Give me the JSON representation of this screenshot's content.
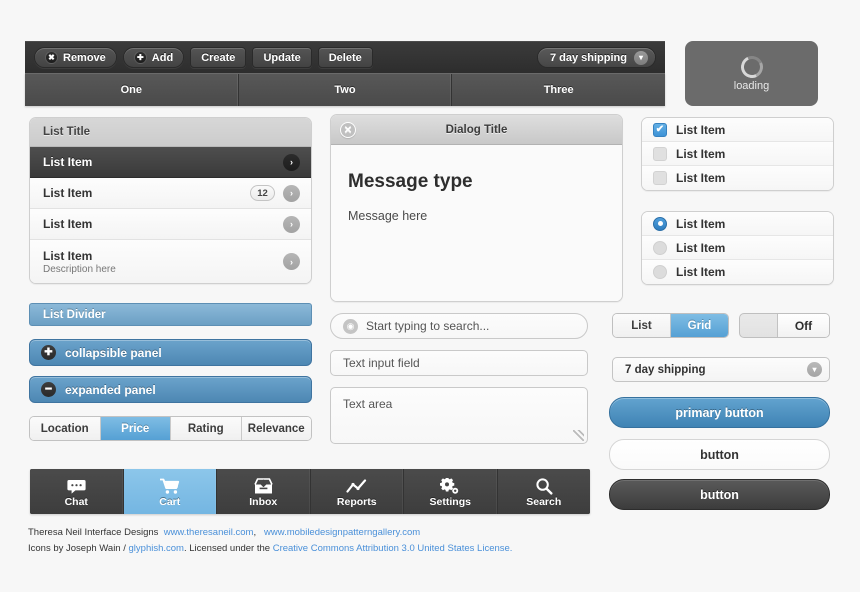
{
  "toolbar": {
    "buttons": [
      {
        "label": "Remove",
        "icon": "close-icon",
        "glyph": "✖",
        "pill": true
      },
      {
        "label": "Add",
        "icon": "plus-icon",
        "glyph": "✚",
        "pill": true
      },
      {
        "label": "Create",
        "icon": null,
        "glyph": "",
        "pill": false
      },
      {
        "label": "Update",
        "icon": null,
        "glyph": "",
        "pill": false
      },
      {
        "label": "Delete",
        "icon": null,
        "glyph": "",
        "pill": false
      }
    ],
    "select": {
      "value": "7 day shipping",
      "chevron": "❯"
    }
  },
  "tabs": [
    {
      "label": "One"
    },
    {
      "label": "Two"
    },
    {
      "label": "Three"
    }
  ],
  "loading": {
    "label": "loading"
  },
  "list": {
    "title": "List Title",
    "items": [
      {
        "label": "List Item",
        "description": "",
        "badge": "",
        "selected": true
      },
      {
        "label": "List Item",
        "description": "",
        "badge": "12",
        "selected": false
      },
      {
        "label": "List Item",
        "description": "",
        "badge": "",
        "selected": false
      },
      {
        "label": "List Item",
        "description": "Description here",
        "badge": "",
        "selected": false
      }
    ],
    "chevron": "❯"
  },
  "divider": {
    "label": "List Divider"
  },
  "panels": {
    "collapsible": {
      "label": "collapsible panel",
      "sign": "✚"
    },
    "expanded": {
      "label": "expanded panel",
      "sign": "━"
    }
  },
  "sort_segment": {
    "options": [
      "Location",
      "Price",
      "Rating",
      "Relevance"
    ],
    "selected": "Price"
  },
  "dialog": {
    "title": "Dialog Title",
    "close_icon": "✕",
    "heading": "Message type",
    "body": "Message here"
  },
  "fields": {
    "search": {
      "placeholder": "Start typing to search...",
      "icon": "search-icon",
      "glyph": "🔍"
    },
    "text_input": {
      "value": "Text input field"
    },
    "text_area": {
      "value": "Text area"
    }
  },
  "check_list": {
    "items": [
      {
        "label": "List Item",
        "checked": true
      },
      {
        "label": "List Item",
        "checked": false
      },
      {
        "label": "List Item",
        "checked": false
      }
    ],
    "check_glyph": "✔"
  },
  "radio_list": {
    "items": [
      {
        "label": "List Item",
        "selected": true
      },
      {
        "label": "List Item",
        "selected": false
      },
      {
        "label": "List Item",
        "selected": false
      }
    ]
  },
  "view_segment": {
    "options": [
      "List",
      "Grid"
    ],
    "selected": "Grid"
  },
  "toggle": {
    "state_label": "Off",
    "on": false
  },
  "shipping_select": {
    "value": "7 day shipping",
    "chevron": "❯"
  },
  "buttons": {
    "primary": "primary button",
    "secondary": "button",
    "dark": "button"
  },
  "tab_bar": {
    "items": [
      {
        "label": "Chat",
        "icon": "chat-bubble-icon",
        "active": false
      },
      {
        "label": "Cart",
        "icon": "shopping-cart-icon",
        "active": true
      },
      {
        "label": "Inbox",
        "icon": "inbox-download-icon",
        "active": false
      },
      {
        "label": "Reports",
        "icon": "line-chart-icon",
        "active": false
      },
      {
        "label": "Settings",
        "icon": "gear-icon",
        "active": false
      },
      {
        "label": "Search",
        "icon": "magnifier-icon",
        "active": false
      }
    ]
  },
  "footer": {
    "line1_text": "Theresa Neil Interface Designs",
    "line1_link1": "www.theresaneil.com",
    "line1_sep": ",",
    "line1_link2": "www.mobiledesignpatterngallery.com",
    "line2_prefix": "Icons by Joseph Wain / ",
    "line2_link1": "glyphish.com",
    "line2_mid": ". Licensed under the ",
    "line2_link2": "Creative Commons Attribution 3.0 United States License."
  },
  "colors": {
    "accent_blue": "#55a0d4",
    "primary_blue": "#3f83b4",
    "dark": "#3d3d3d",
    "page_bg": "#f7f7f7"
  }
}
